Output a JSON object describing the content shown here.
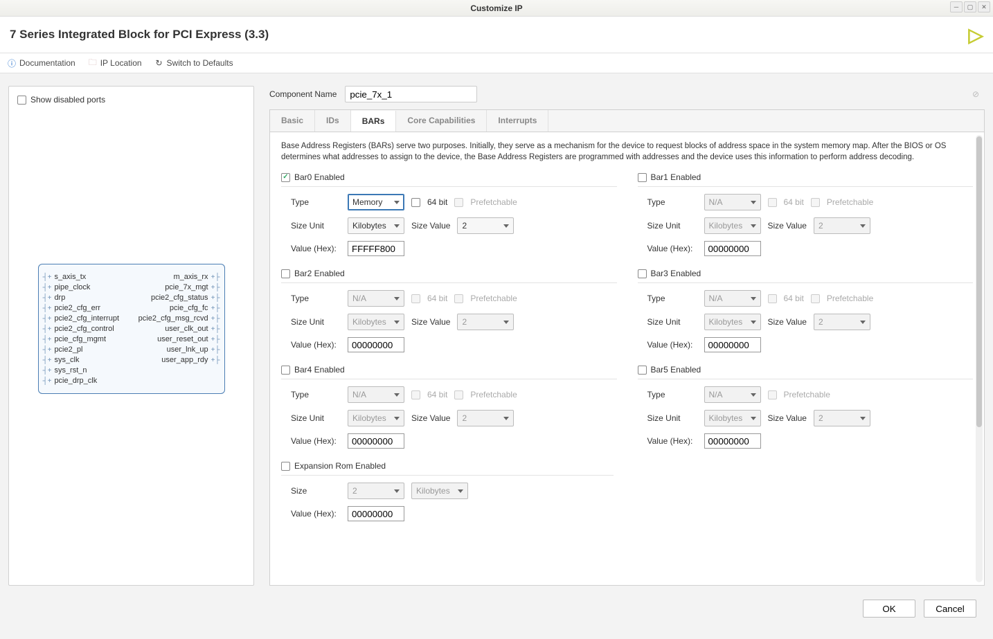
{
  "window": {
    "title": "Customize IP"
  },
  "header": {
    "title": "7 Series Integrated Block for PCI Express (3.3)"
  },
  "toolbar": {
    "documentation": "Documentation",
    "ip_location": "IP Location",
    "switch_defaults": "Switch to Defaults"
  },
  "left": {
    "show_disabled_ports": "Show disabled ports",
    "ports_left": [
      "s_axis_tx",
      "pipe_clock",
      "drp",
      "pcie2_cfg_err",
      "pcie2_cfg_interrupt",
      "pcie2_cfg_control",
      "pcie_cfg_mgmt",
      "pcie2_pl",
      "sys_clk",
      "sys_rst_n",
      "pcie_drp_clk"
    ],
    "ports_right": [
      "m_axis_rx",
      "pcie_7x_mgt",
      "pcie2_cfg_status",
      "pcie_cfg_fc",
      "pcie2_cfg_msg_rcvd",
      "user_clk_out",
      "user_reset_out",
      "user_lnk_up",
      "user_app_rdy"
    ]
  },
  "component": {
    "label": "Component Name",
    "value": "pcie_7x_1"
  },
  "tabs": [
    "Basic",
    "IDs",
    "BARs",
    "Core Capabilities",
    "Interrupts"
  ],
  "active_tab": "BARs",
  "desc": "Base Address Registers (BARs) serve two purposes. Initially, they serve as a mechanism for the device to request blocks of address space in the system memory map. After the BIOS or OS determines what addresses to assign to the device, the Base Address Registers are programmed with addresses and the device uses this information to perform address decoding.",
  "labels": {
    "type": "Type",
    "size_unit": "Size Unit",
    "size_value": "Size Value",
    "value_hex": "Value (Hex):",
    "bit64": "64 bit",
    "prefetch": "Prefetchable",
    "size": "Size"
  },
  "bars": [
    {
      "name": "Bar0 Enabled",
      "enabled": true,
      "type": "Memory",
      "type_active": true,
      "bit64": false,
      "bit64_dis": false,
      "prefetch_dis": true,
      "show_bit64": true,
      "unit": "Kilobytes",
      "size": "2",
      "hex": "FFFFF800"
    },
    {
      "name": "Bar1 Enabled",
      "enabled": false,
      "type": "N/A",
      "type_active": false,
      "bit64": false,
      "bit64_dis": true,
      "prefetch_dis": true,
      "show_bit64": true,
      "unit": "Kilobytes",
      "size": "2",
      "hex": "00000000"
    },
    {
      "name": "Bar2 Enabled",
      "enabled": false,
      "type": "N/A",
      "type_active": false,
      "bit64": false,
      "bit64_dis": true,
      "prefetch_dis": true,
      "show_bit64": true,
      "unit": "Kilobytes",
      "size": "2",
      "hex": "00000000"
    },
    {
      "name": "Bar3 Enabled",
      "enabled": false,
      "type": "N/A",
      "type_active": false,
      "bit64": false,
      "bit64_dis": true,
      "prefetch_dis": true,
      "show_bit64": true,
      "unit": "Kilobytes",
      "size": "2",
      "hex": "00000000"
    },
    {
      "name": "Bar4 Enabled",
      "enabled": false,
      "type": "N/A",
      "type_active": false,
      "bit64": false,
      "bit64_dis": true,
      "prefetch_dis": true,
      "show_bit64": true,
      "unit": "Kilobytes",
      "size": "2",
      "hex": "00000000"
    },
    {
      "name": "Bar5 Enabled",
      "enabled": false,
      "type": "N/A",
      "type_active": false,
      "bit64": false,
      "bit64_dis": true,
      "prefetch_dis": true,
      "show_bit64": false,
      "unit": "Kilobytes",
      "size": "2",
      "hex": "00000000"
    }
  ],
  "exp_rom": {
    "name": "Expansion Rom Enabled",
    "enabled": false,
    "size": "2",
    "unit": "Kilobytes",
    "hex": "00000000"
  },
  "footer": {
    "ok": "OK",
    "cancel": "Cancel"
  }
}
